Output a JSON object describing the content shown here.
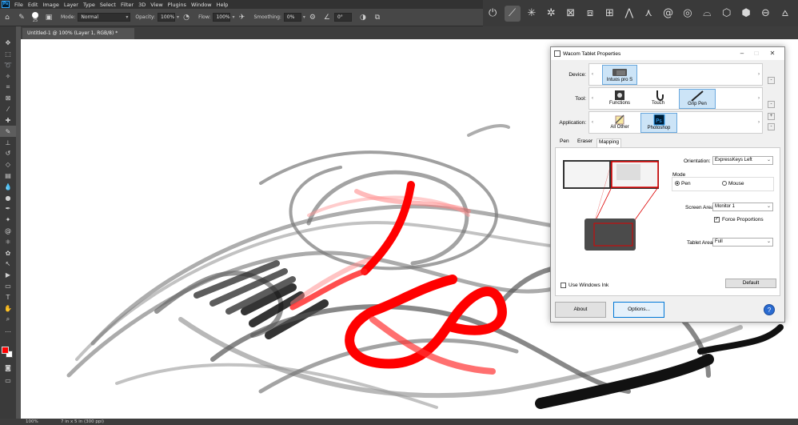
{
  "menubar": {
    "logo": "Ps",
    "items": [
      "File",
      "Edit",
      "Image",
      "Layer",
      "Type",
      "Select",
      "Filter",
      "3D",
      "View",
      "Plugins",
      "Window",
      "Help"
    ]
  },
  "options": {
    "brush_size": "25",
    "mode_label": "Mode:",
    "mode_value": "Normal",
    "opacity_label": "Opacity:",
    "opacity_value": "100%",
    "flow_label": "Flow:",
    "flow_value": "100%",
    "smoothing_label": "Smoothing:",
    "smoothing_value": "0%",
    "angle_value": "0°"
  },
  "document": {
    "tab_title": "Untitled-1 @ 100% (Layer 1, RGB/8) *"
  },
  "status": {
    "zoom": "100%",
    "doc_size": "7 in x 5 in (300 ppi)"
  },
  "colors": {
    "foreground": "#ff0000",
    "background": "#ffffff",
    "accent": "#0078d7"
  },
  "wacom": {
    "title": "Wacom Tablet Properties",
    "device_label": "Device:",
    "tool_label": "Tool:",
    "application_label": "Application:",
    "devices": [
      {
        "name": "Intuos pro S",
        "icon": "tablet-icon",
        "selected": true
      }
    ],
    "tools": [
      {
        "name": "Functions",
        "icon": "functions-icon",
        "selected": false
      },
      {
        "name": "Touch",
        "icon": "touch-hand-icon",
        "selected": false
      },
      {
        "name": "Grip Pen",
        "icon": "pen-icon",
        "selected": true
      }
    ],
    "applications": [
      {
        "name": "All Other",
        "icon": "all-other-icon",
        "selected": false
      },
      {
        "name": "Photoshop",
        "icon": "photoshop-icon",
        "selected": true
      }
    ],
    "tabs": [
      "Pen",
      "Eraser",
      "Mapping"
    ],
    "active_tab": "Mapping",
    "orientation_label": "Orientation:",
    "orientation_value": "ExpressKeys Left",
    "mode_group_label": "Mode",
    "mode_pen": "Pen",
    "mode_mouse": "Mouse",
    "screen_area_label": "Screen Area:",
    "screen_area_value": "Monitor 1",
    "force_proportions": "Force Proportions",
    "tablet_area_label": "Tablet Area:",
    "tablet_area_value": "Full",
    "use_windows_ink": "Use Windows Ink",
    "default_button": "Default",
    "about_button": "About",
    "options_button": "Options...",
    "help_button": "?"
  }
}
